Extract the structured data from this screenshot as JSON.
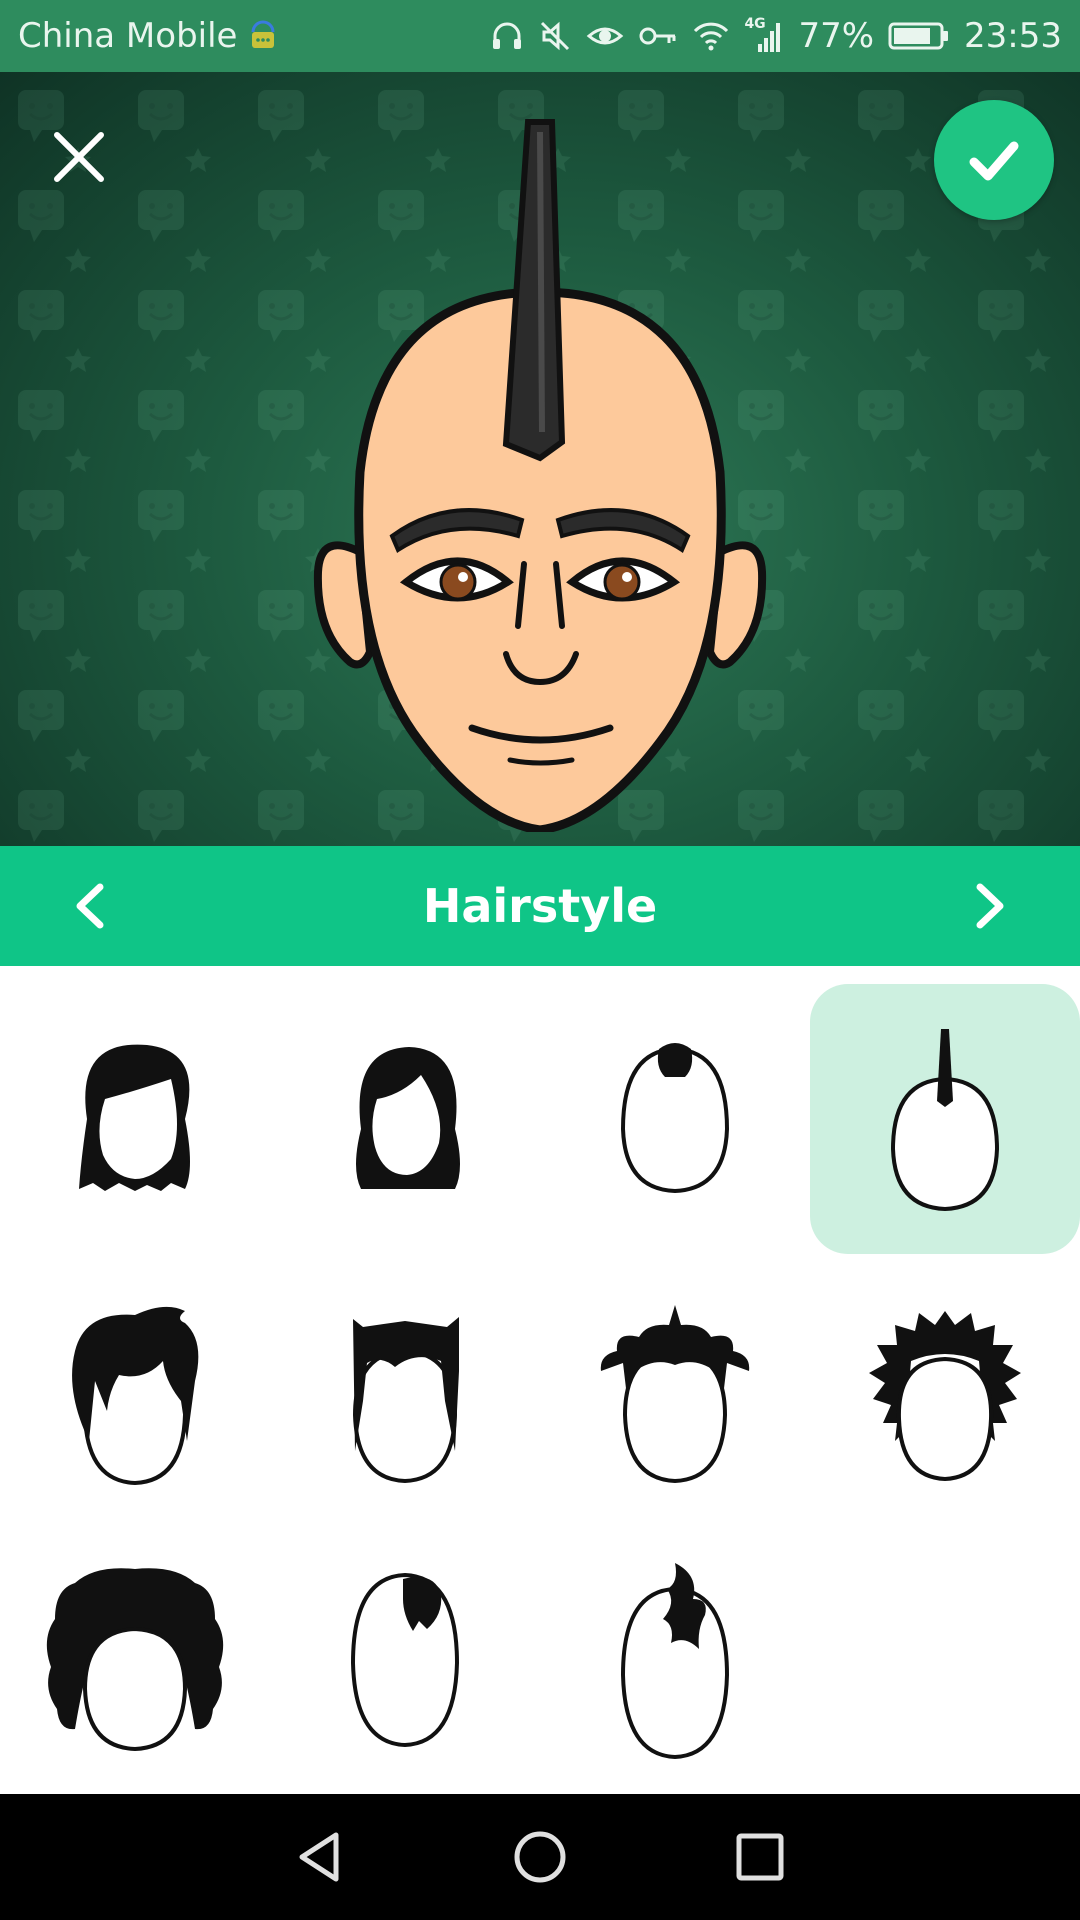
{
  "status_bar": {
    "carrier": "China Mobile",
    "network": "4G",
    "battery": "77%",
    "time": "23:53",
    "icons": [
      "sim-chat-icon",
      "headphones-icon",
      "mute-icon",
      "eye-icon",
      "key-icon",
      "wifi-icon",
      "signal-icon",
      "battery-icon"
    ]
  },
  "editor": {
    "close_icon": "close-icon",
    "confirm_icon": "check-icon",
    "category": "Hairstyle",
    "prev_icon": "chevron-left-icon",
    "next_icon": "chevron-right-icon"
  },
  "hairstyles": {
    "selected_index": 3,
    "options": [
      "long-side-part",
      "bob",
      "tuft-top",
      "mohawk-spike",
      "messy-layered",
      "bowl-flipped",
      "spiky-buns",
      "spiky-all-around",
      "afro-curly",
      "small-tuft",
      "side-flame"
    ]
  },
  "colors": {
    "status_bar": "#2e8c5e",
    "accent": "#0fc587",
    "confirm": "#1fc483",
    "selected_tile": "#cdf0e0",
    "skin": "#fdc99b"
  },
  "system_nav": {
    "icons": [
      "back-icon",
      "home-icon",
      "recents-icon"
    ]
  }
}
